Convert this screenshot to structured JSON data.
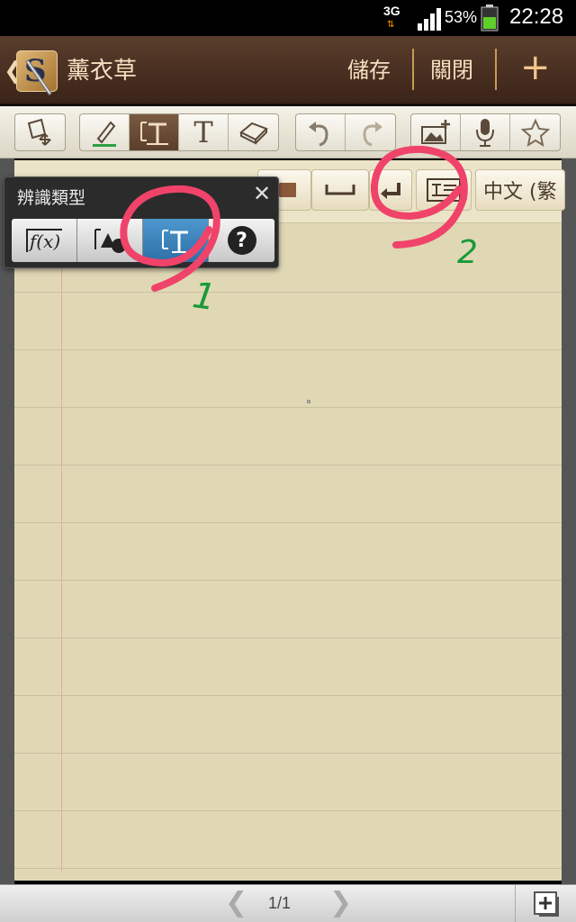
{
  "status": {
    "network": "3G",
    "battery_pct": "53%",
    "time": "22:28"
  },
  "titlebar": {
    "app_logo_letter": "S",
    "note_title": "薰衣草",
    "save_label": "儲存",
    "close_label": "關閉",
    "add_label": "+"
  },
  "toolbar": {
    "icons": [
      "page-move-icon",
      "pen-icon",
      "text-recognition-icon",
      "text-icon",
      "eraser-icon",
      "undo-icon",
      "redo-icon",
      "insert-image-icon",
      "microphone-icon",
      "star-icon"
    ],
    "text_tool_glyph": "T"
  },
  "subbar": {
    "language_label": "中文 (繁"
  },
  "popup": {
    "title": "辨識類型",
    "close": "✕",
    "options": [
      {
        "label": "f(x)",
        "icon": "formula-icon"
      },
      {
        "label": "",
        "icon": "shape-icon"
      },
      {
        "label": "T",
        "icon": "text-recognition-icon"
      },
      {
        "label": "?",
        "icon": "help-icon"
      }
    ]
  },
  "annotations": {
    "label_1": "1",
    "label_2": "2",
    "circle_color": "#f0436a",
    "number_color": "#1a9a3a"
  },
  "bottom": {
    "page_indicator": "1/1"
  }
}
